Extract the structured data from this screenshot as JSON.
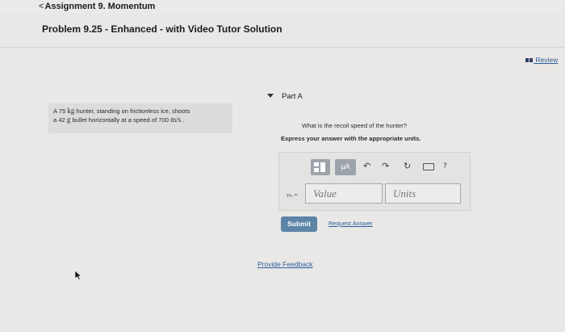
{
  "header": {
    "back_chevron": "<",
    "back_label": "Assignment 9. Momentum",
    "problem_title": "Problem 9.25 - Enhanced - with Video Tutor Solution"
  },
  "review": {
    "label": "Review"
  },
  "problem": {
    "l1_a": "A 75 ",
    "l1_unit": "kg",
    "l1_b": " hunter, standing on frictionless ice, shoots",
    "l2_a": "a 42 ",
    "l2_unit": "g",
    "l2_b": " bullet horizontally at a speed of 700 ",
    "l2_unit2": "m/s",
    "l2_c": " ."
  },
  "part": {
    "label": "Part A",
    "question": "What is the recoil speed of the hunter?",
    "instruction": "Express your answer with the appropriate units."
  },
  "toolbar": {
    "mu_label": "μA",
    "undo_glyph": "↶",
    "redo_glyph": "↷",
    "reset_glyph": "↻",
    "help_glyph": "?"
  },
  "answer": {
    "variable_label": "vₕ =",
    "value_placeholder": "Value",
    "units_placeholder": "Units"
  },
  "actions": {
    "submit_label": "Submit",
    "request_label": "Request Answer"
  },
  "footer": {
    "feedback_label": "Provide Feedback"
  },
  "colors": {
    "submit_bg": "#5c84a6",
    "link": "#2e5e9a",
    "toolbar_button": "#9da3ab"
  }
}
